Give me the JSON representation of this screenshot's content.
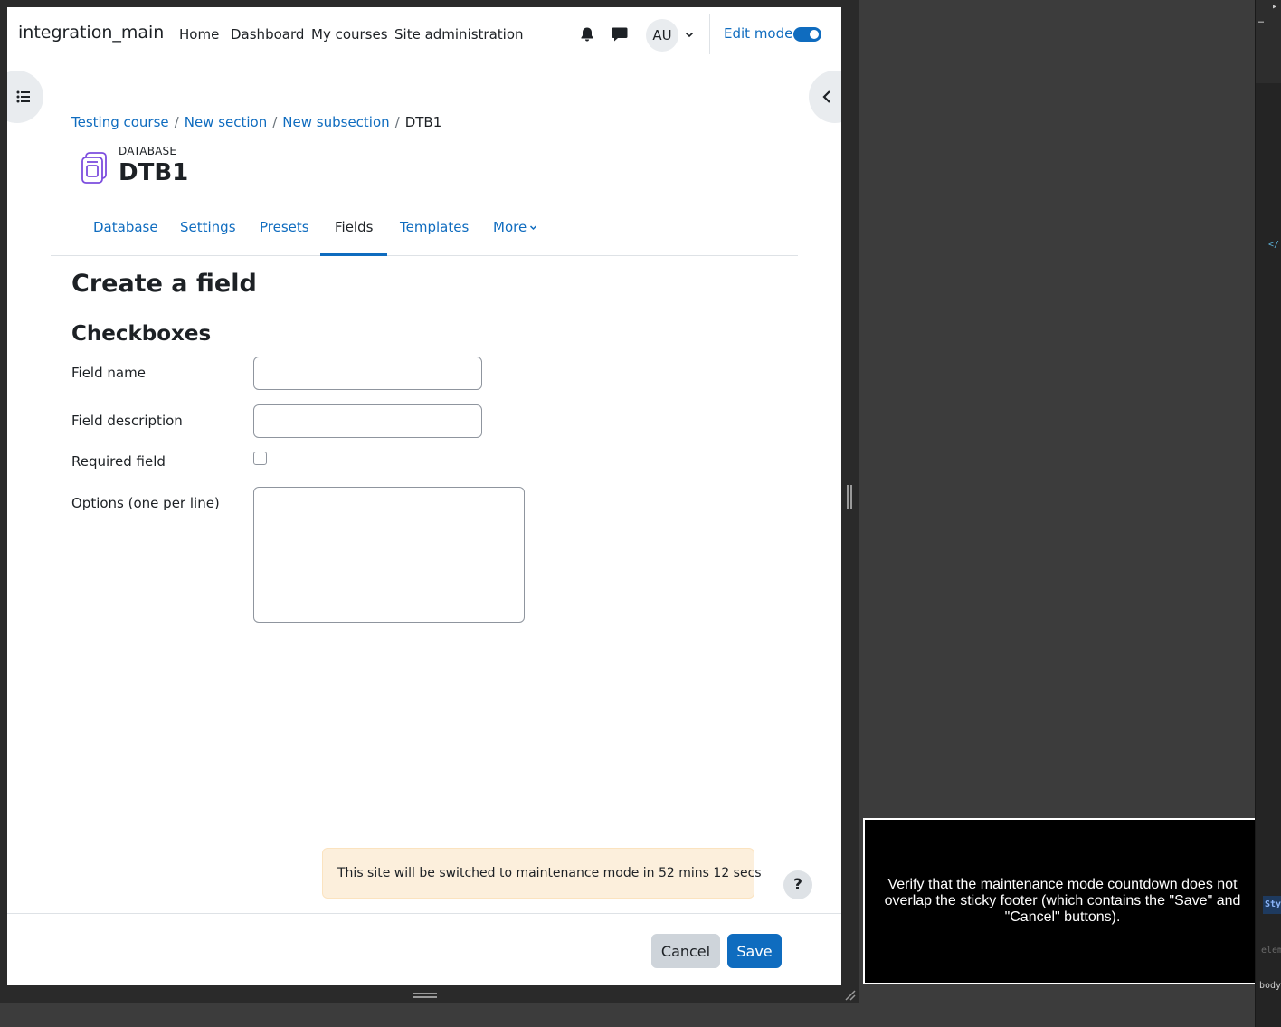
{
  "navbar": {
    "site_name": "integration_main",
    "links": [
      "Home",
      "Dashboard",
      "My courses",
      "Site administration"
    ],
    "avatar_initials": "AU",
    "edit_mode_label": "Edit mode",
    "edit_mode_on": true
  },
  "breadcrumb": {
    "items": [
      "Testing course",
      "New section",
      "New subsection"
    ],
    "current": "DTB1",
    "separator": "/"
  },
  "activity": {
    "type": "DATABASE",
    "title": "DTB1"
  },
  "tabs": {
    "items": [
      "Database",
      "Settings",
      "Presets",
      "Fields",
      "Templates",
      "More"
    ],
    "active": "Fields"
  },
  "page": {
    "heading": "Create a field",
    "field_type": "Checkboxes"
  },
  "form": {
    "field_name_label": "Field name",
    "field_name_value": "",
    "field_description_label": "Field description",
    "field_description_value": "",
    "required_label": "Required field",
    "required_checked": false,
    "options_label": "Options (one per line)",
    "options_value": ""
  },
  "maintenance": {
    "message": "This site will be switched to maintenance mode in 52 mins 12 secs"
  },
  "help": {
    "label": "?"
  },
  "footer": {
    "cancel_label": "Cancel",
    "save_label": "Save"
  },
  "instruction": {
    "text": "Verify that the maintenance mode countdown does not overlap the sticky footer (which contains the \"Save\" and \"Cancel\" buttons)."
  },
  "devtools": {
    "top_glyph": "▸",
    "ellipsis": "…",
    "close_tag": "</",
    "styles_tab": "Sty",
    "filter_placeholder": "elem",
    "body_tag": "body"
  },
  "colors": {
    "brand": "#0f6cbf",
    "text": "#1d2125",
    "alert_bg": "#fcefdc",
    "secondary_btn": "#ced4da"
  }
}
